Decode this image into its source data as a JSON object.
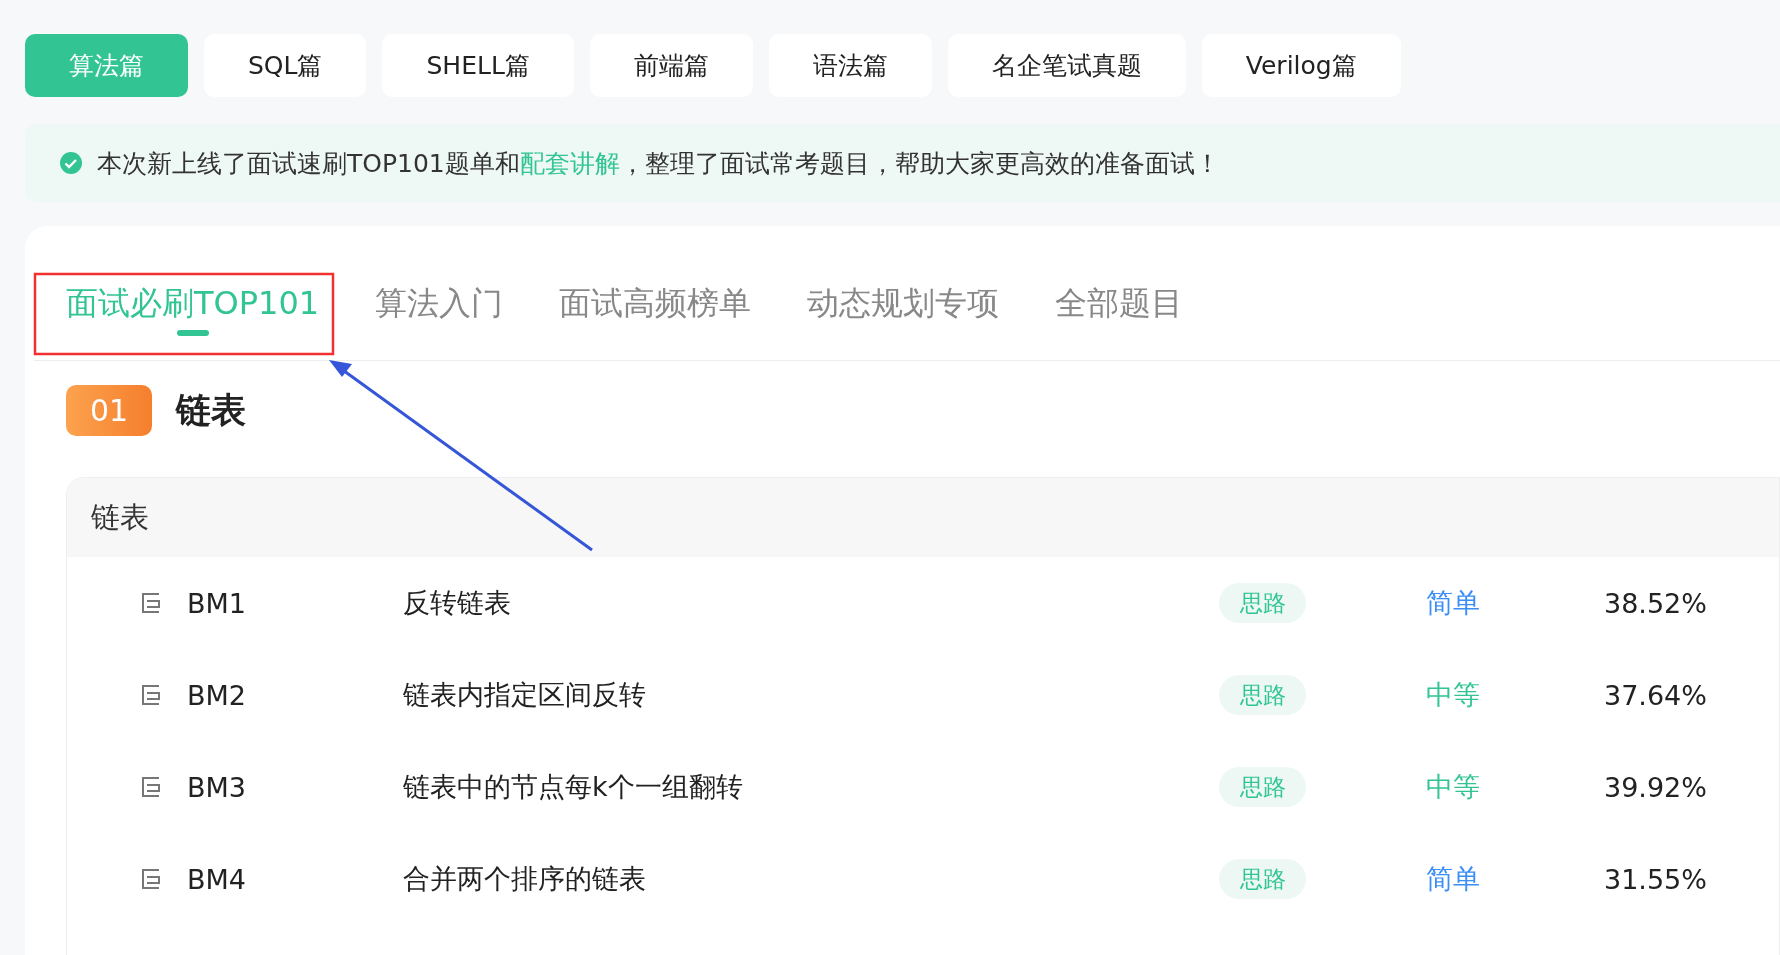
{
  "top_tabs": [
    {
      "label": "算法篇",
      "selected": true
    },
    {
      "label": "SQL篇",
      "selected": false
    },
    {
      "label": "SHELL篇",
      "selected": false
    },
    {
      "label": "前端篇",
      "selected": false
    },
    {
      "label": "语法篇",
      "selected": false
    },
    {
      "label": "名企笔试真题",
      "selected": false
    },
    {
      "label": "Verilog篇",
      "selected": false
    }
  ],
  "notice": {
    "before": "本次新上线了面试速刷TOP101题单和",
    "link": "配套讲解",
    "after": "，整理了面试常考题目，帮助大家更高效的准备面试！"
  },
  "sub_tabs": [
    {
      "label": "面试必刷TOP101",
      "selected": true
    },
    {
      "label": "算法入门",
      "selected": false
    },
    {
      "label": "面试高频榜单",
      "selected": false
    },
    {
      "label": "动态规划专项",
      "selected": false
    },
    {
      "label": "全部题目",
      "selected": false
    }
  ],
  "chapter": {
    "number": "01",
    "title": "链表"
  },
  "section": {
    "title": "链表",
    "rows": [
      {
        "id": "BM1",
        "title": "反转链表",
        "tag": "思路",
        "difficulty": "简单",
        "color": "#3a8ef6",
        "rate": "38.52%"
      },
      {
        "id": "BM2",
        "title": "链表内指定区间反转",
        "tag": "思路",
        "difficulty": "中等",
        "color": "#32c593",
        "rate": "37.64%"
      },
      {
        "id": "BM3",
        "title": "链表中的节点每k个一组翻转",
        "tag": "思路",
        "difficulty": "中等",
        "color": "#32c593",
        "rate": "39.92%"
      },
      {
        "id": "BM4",
        "title": "合并两个排序的链表",
        "tag": "思路",
        "difficulty": "简单",
        "color": "#3a8ef6",
        "rate": "31.55%"
      }
    ]
  }
}
